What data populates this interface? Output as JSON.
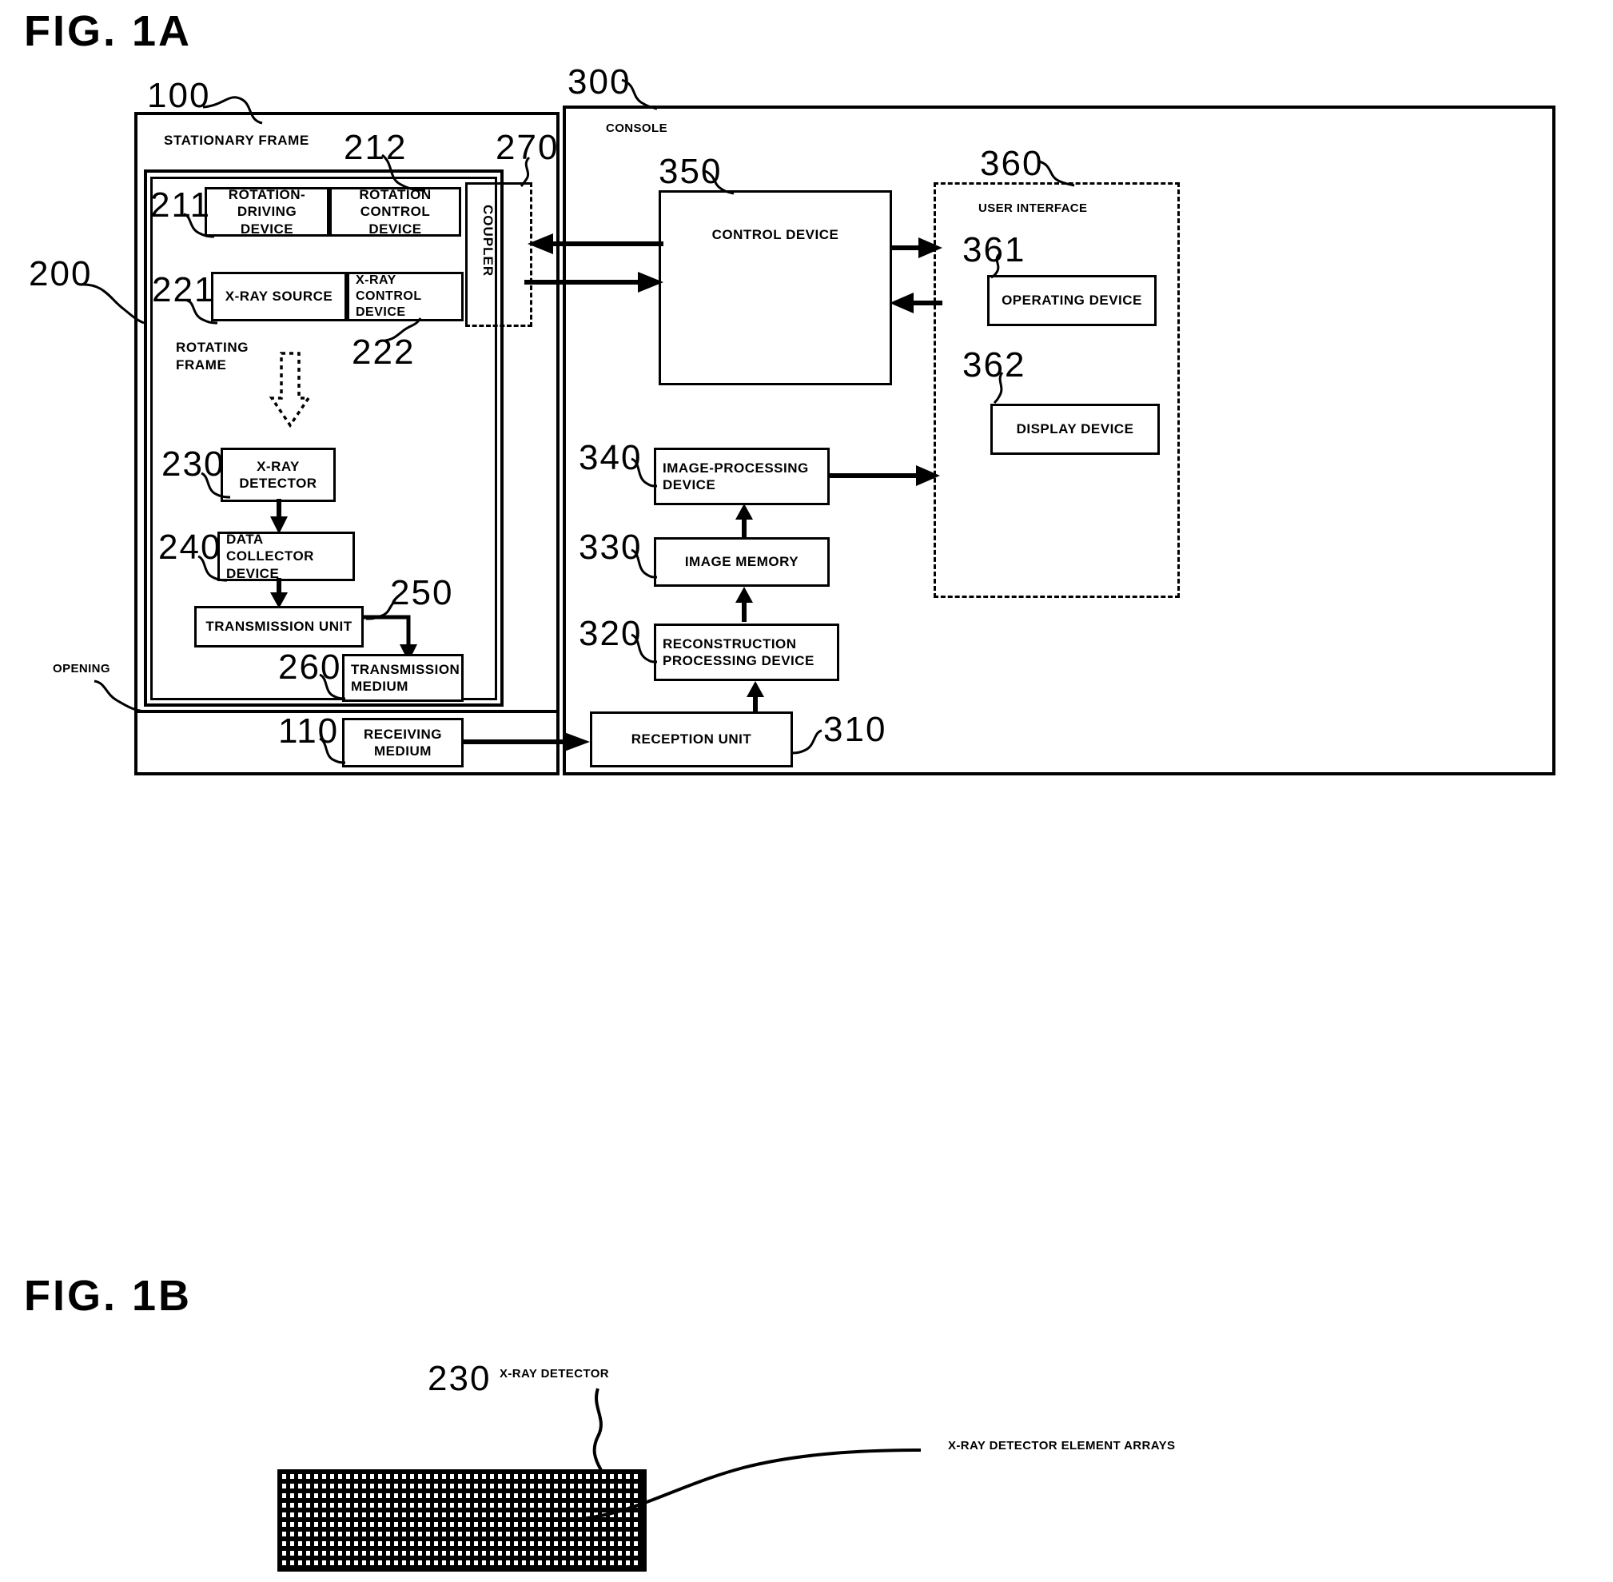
{
  "figures": {
    "fig1a_title": "FIG. 1A",
    "fig1b_title": "FIG. 1B"
  },
  "fig1a": {
    "gantry": {
      "ref": "100",
      "stationary_frame_label": "STATIONARY FRAME",
      "rotating_frame_label": "ROTATING\nFRAME",
      "rotating_frame_ref": "200",
      "opening_label": "OPENING",
      "coupler_label": "COUPLER",
      "coupler_ref": "270",
      "boxes": [
        {
          "ref": "211",
          "label": "ROTATION-\nDRIVING DEVICE"
        },
        {
          "ref": "212",
          "label": "ROTATION\nCONTROL DEVICE"
        },
        {
          "ref": "221",
          "label": "X-RAY SOURCE"
        },
        {
          "ref": "222",
          "label": "X-RAY CONTROL\nDEVICE"
        },
        {
          "ref": "230",
          "label": "X-RAY\nDETECTOR"
        },
        {
          "ref": "240",
          "label": "DATA COLLECTOR\nDEVICE"
        },
        {
          "ref": "250",
          "label": "TRANSMISSION UNIT"
        },
        {
          "ref": "260",
          "label": "TRANSMISSION\nMEDIUM"
        },
        {
          "ref": "110",
          "label": "RECEIVING\nMEDIUM"
        }
      ]
    },
    "console": {
      "ref": "300",
      "label": "CONSOLE",
      "boxes": [
        {
          "ref": "350",
          "label": "CONTROL  DEVICE"
        },
        {
          "ref": "340",
          "label": "IMAGE-PROCESSING\nDEVICE"
        },
        {
          "ref": "330",
          "label": "IMAGE MEMORY"
        },
        {
          "ref": "320",
          "label": "RECONSTRUCTION\nPROCESSING DEVICE"
        },
        {
          "ref": "310",
          "label": "RECEPTION UNIT"
        }
      ]
    },
    "user_interface": {
      "ref": "360",
      "label": "USER INTERFACE",
      "boxes": [
        {
          "ref": "361",
          "label": "OPERATING DEVICE"
        },
        {
          "ref": "362",
          "label": "DISPLAY DEVICE"
        }
      ]
    }
  },
  "fig1b": {
    "detector_ref": "230",
    "detector_label": "X-RAY DETECTOR",
    "element_arrays_label": "X-RAY DETECTOR ELEMENT ARRAYS"
  },
  "colors": {
    "ink": "#000000",
    "paper": "#ffffff"
  }
}
